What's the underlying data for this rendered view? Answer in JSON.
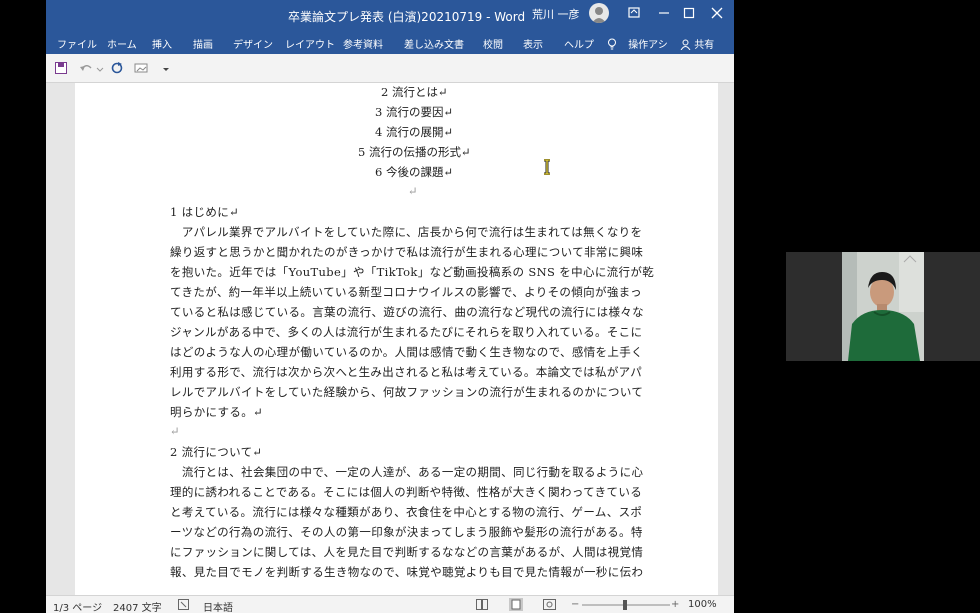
{
  "window": {
    "title": "卒業論文プレ発表 (白濱)20210719  -  Word",
    "user": "荒川 一彦"
  },
  "ribbon": {
    "tabs": [
      "ファイル",
      "ホーム",
      "挿入",
      "描画",
      "デザイン",
      "レイアウト",
      "参考資料",
      "差し込み文書",
      "校閲",
      "表示",
      "ヘルプ"
    ],
    "tell_me": "操作アシ",
    "share": "共有"
  },
  "document": {
    "toc": [
      "2 流行とは↵",
      "3 流行の要因↵",
      "4 流行の展開↵",
      "5 流行の伝播の形式↵",
      "6 今後の課題↵"
    ],
    "blank_mark": "↵",
    "section1_heading": "1 はじめに↵",
    "section1_lines": [
      "　アパレル業界でアルバイトをしていた際に、店長から何で流行は生まれては無くなりを",
      "繰り返すと思うかと聞かれたのがきっかけで私は流行が生まれる心理について非常に興味",
      "を抱いた。近年では「YouTube」や「TikTok」など動画投稿系の SNS を中心に流行が乾",
      "てきたが、約一年半以上続いている新型コロナウイルスの影響で、よりその傾向が強まっ",
      "ていると私は感じている。言葉の流行、遊びの流行、曲の流行など現代の流行には様々な",
      "ジャンルがある中で、多くの人は流行が生まれるたびにそれらを取り入れている。そこに",
      "はどのような人の心理が働いているのか。人間は感情で動く生き物なので、感情を上手く",
      "利用する形で、流行は次から次へと生み出されると私は考えている。本論文では私がアパ",
      "レルでアルバイトをしていた経験から、何故ファッションの流行が生まれるのかについて",
      "明らかにする。↵"
    ],
    "section2_heading": "2 流行について↵",
    "section2_lines": [
      "　流行とは、社会集団の中で、一定の人達が、ある一定の期間、同じ行動を取るように心",
      "理的に誘われることである。そこには個人の判断や特徴、性格が大きく関わってきている",
      "と考えている。流行には様々な種類があり、衣食住を中心とする物の流行、ゲーム、スポ",
      "ーツなどの行為の流行、その人の第一印象が決まってしまう服飾や髪形の流行がある。特",
      "にファッションに関しては、人を見た目で判断するななどの言葉があるが、人間は視覚情",
      "報、見た目でモノを判断する生き物なので、味覚や聴覚よりも目で見た情報が一秒に伝わ"
    ]
  },
  "status": {
    "page": "1/3 ページ",
    "words": "2407 文字",
    "language": "日本語",
    "zoom": "100%"
  },
  "colors": {
    "ribbon": "#2b579a",
    "background": "#000000"
  }
}
